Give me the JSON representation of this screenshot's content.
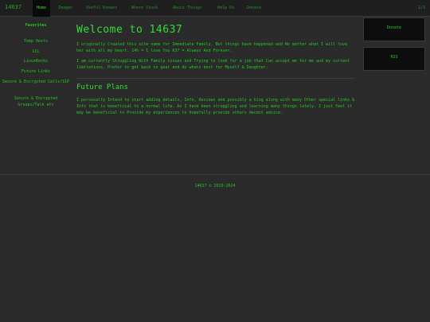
{
  "header": {
    "brand": "14637",
    "nav": [
      "Home",
      "Images",
      "Useful Knowns",
      "Where Stock",
      "About Things",
      "Help Us",
      "Donate"
    ],
    "right_label": "1/3"
  },
  "sidebar": {
    "items": [
      "Favorites",
      "Temp Hosts",
      "LCL",
      "LinuxRocks",
      "Future Links",
      "Secure & Encrypted Calls/SIP",
      "Secure & Encrypted Groups/Talk etc"
    ]
  },
  "main": {
    "title": "Welcome to 14637",
    "paragraph1": "I originally Created this site name for Immediate Family. But things have happened and No matter what I will love her with all my heart. 14% = I love You 637 = Always And Forever.",
    "paragraph2": "I am currently Struggling With Family issues and Trying to look for a job that Can accept me for me and my current limitations. Prefer to get back in gear and do whats best for Myself & Daughter.",
    "subtitle": "Future Plans",
    "paragraph3": "I personally Intend to start adding details, Info, Reviews and possibly a blog along with many Other special links & Info that is beneficial to a normal life. As I have been struggling and learning many things lately. I just feel it may be beneficial to Provide my experiences to hopefully provide others decent advice."
  },
  "right": {
    "box1": "Donate",
    "box2": "RSS"
  },
  "footer": {
    "text": "14637 © 2019-2024"
  },
  "colors": {
    "accent": "#22cc22",
    "background": "#2b2b2b"
  }
}
